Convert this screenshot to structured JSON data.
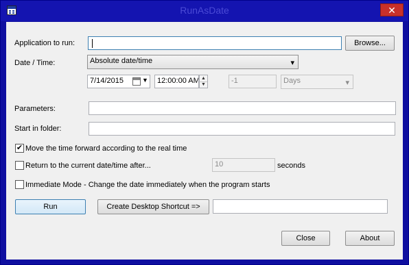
{
  "window": {
    "title": "RunAsDate",
    "close_glyph": "✕"
  },
  "app": {
    "label": "Application to run:",
    "value": "",
    "browse_label": "Browse..."
  },
  "datetime": {
    "label": "Date / Time:",
    "mode_value": "Absolute date/time",
    "date_value": "7/14/2015",
    "time_value": "12:00:00 AM",
    "offset_value": "-1",
    "unit_value": "Days"
  },
  "params": {
    "label": "Parameters:",
    "value": ""
  },
  "start_folder": {
    "label": "Start in folder:",
    "value": ""
  },
  "options": {
    "move_forward": {
      "label": "Move the time forward according to the real time",
      "checked": true,
      "mark": "✔"
    },
    "return_current": {
      "label": "Return to the current date/time after...",
      "checked": false,
      "seconds_value": "10",
      "seconds_label": "seconds"
    },
    "immediate": {
      "label": "Immediate Mode - Change the date immediately when the program starts",
      "checked": false
    }
  },
  "actions": {
    "run_label": "Run",
    "shortcut_label": "Create Desktop Shortcut =>",
    "shortcut_name_value": ""
  },
  "footer": {
    "close_label": "Close",
    "about_label": "About"
  }
}
